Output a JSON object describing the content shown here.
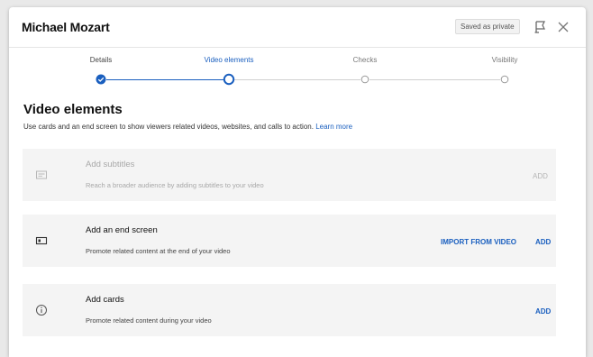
{
  "dialog": {
    "title": "Michael Mozart",
    "saved_badge": "Saved as private",
    "flag_icon": "flag-icon",
    "close_icon": "close-icon"
  },
  "stepper": {
    "steps": [
      {
        "label": "Details",
        "state": "complete"
      },
      {
        "label": "Video elements",
        "state": "current"
      },
      {
        "label": "Checks",
        "state": "upcoming"
      },
      {
        "label": "Visibility",
        "state": "upcoming"
      }
    ],
    "accent_color": "#1a5fbf"
  },
  "section": {
    "title": "Video elements",
    "description": "Use cards and an end screen to show viewers related videos, websites, and calls to action.",
    "learn_more": "Learn more"
  },
  "cards": [
    {
      "title": "Add subtitles",
      "description": "Reach a broader audience by adding subtitles to your video",
      "action": "ADD",
      "icon": "subtitles-icon",
      "enabled": false
    },
    {
      "title": "Add an end screen",
      "description": "Promote related content at the end of your video",
      "secondary_action": "IMPORT FROM VIDEO",
      "action": "ADD",
      "icon": "end-screen-icon",
      "enabled": true
    },
    {
      "title": "Add cards",
      "description": "Promote related content during your video",
      "action": "ADD",
      "icon": "info-icon",
      "enabled": true
    }
  ]
}
